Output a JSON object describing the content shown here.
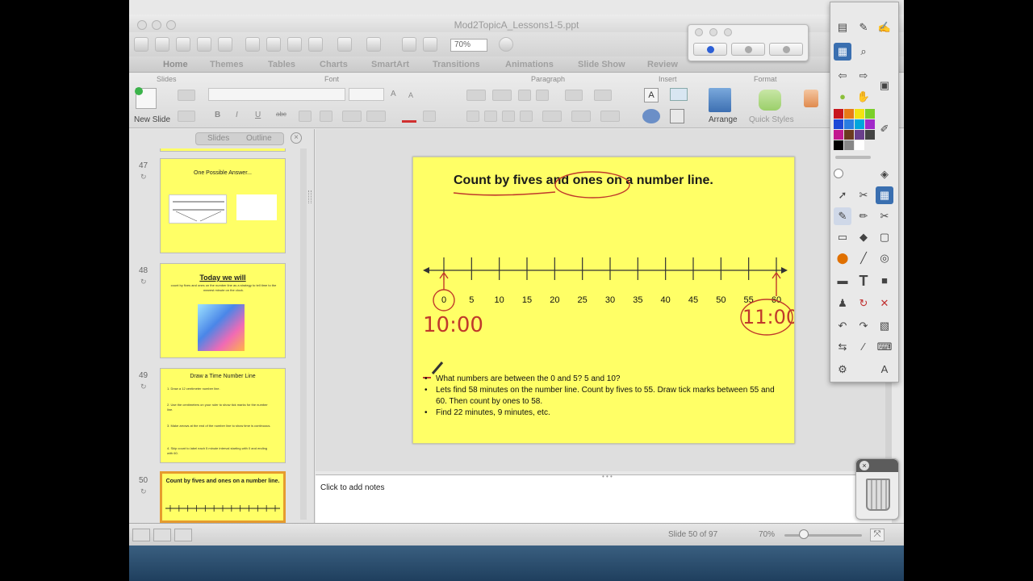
{
  "window": {
    "title": "Mod2TopicA_Lessons1-5.ppt",
    "zoom_value": "70%"
  },
  "ribbon_tabs": [
    "Home",
    "Themes",
    "Tables",
    "Charts",
    "SmartArt",
    "Transitions",
    "Animations",
    "Slide Show",
    "Review"
  ],
  "ribbon": {
    "groups": {
      "slides": "Slides",
      "font": "Font",
      "paragraph": "Paragraph",
      "insert": "Insert",
      "format": "Format"
    },
    "new_slide_label": "New Slide",
    "arrange_label": "Arrange",
    "quick_styles_label": "Quick Styles",
    "font_buttons": {
      "bold": "B",
      "italic": "I",
      "underline": "U",
      "grow": "A",
      "shrink": "A",
      "abc": "abc"
    }
  },
  "slide_panel": {
    "tab_slides": "Slides",
    "tab_outline": "Outline",
    "thumbnails": [
      {
        "number": "47",
        "title": "One Possible Answer..."
      },
      {
        "number": "48",
        "title": "Today we will",
        "body": "count by fives and ones on the number line as a strategy to tell time to the nearest minute on the clock."
      },
      {
        "number": "49",
        "title": "Draw a Time Number Line",
        "body_lines": [
          "1.  Draw a 12 centimeter number line.",
          "2.  Use the centimeters on your ruler to show tick marks for the number line.",
          "3.  Make arrows at the end of the number line to show time is continuous.",
          "4.  Skip count to label each 5 minute interval starting with 0 and ending with 60."
        ]
      },
      {
        "number": "50",
        "title": "Count by fives and ones on a number line."
      }
    ]
  },
  "slide": {
    "title": "Count by fives and ones on a number line.",
    "tick_labels": [
      "0",
      "5",
      "10",
      "15",
      "20",
      "25",
      "30",
      "35",
      "40",
      "45",
      "50",
      "55",
      "60"
    ],
    "annotation_start": "10:00",
    "annotation_end": "11:00",
    "bullets": [
      "What numbers are between the 0 and 5?  5 and 10?",
      "Lets find 58 minutes on the number line. Count by fives to 55.  Draw tick marks between 55 and 60.  Then count by ones to 58.",
      "Find 22 minutes, 9 minutes, etc."
    ]
  },
  "notes": {
    "placeholder": "Click to add notes"
  },
  "status": {
    "slide_position": "Slide 50 of 97",
    "zoom": "70%",
    "zoom_fraction": 0.25
  },
  "palette_colors": [
    "#c8161e",
    "#e87a17",
    "#f3e311",
    "#7bcf2a",
    "#1d47d6",
    "#2a7de1",
    "#00a6dd",
    "#a129c9",
    "#c2188f",
    "#6b3a1f",
    "#6a3f8c",
    "#444444",
    "#000000",
    "#888888",
    "#ffffff"
  ],
  "floating_palette_dot_color": "#2c5fd6"
}
